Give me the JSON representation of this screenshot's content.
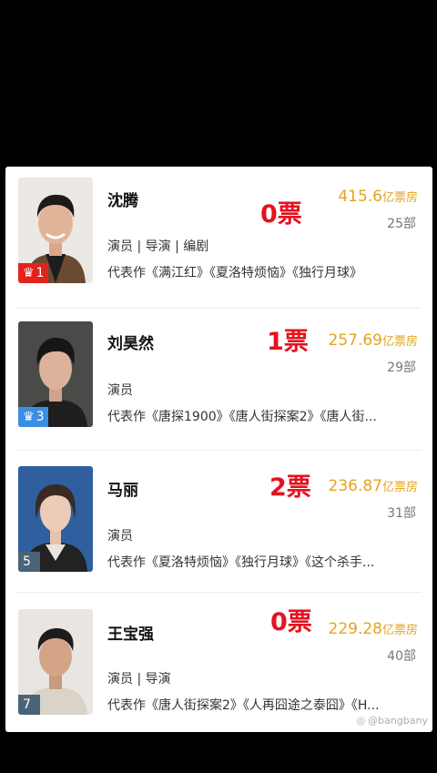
{
  "rows": [
    {
      "rank": "1",
      "rank_color": "#e3231d",
      "crown": true,
      "name": "沈腾",
      "votes": "0票",
      "box_value": "415.6",
      "box_unit": "亿票房",
      "count": "25部",
      "roles": "演员 | 导演 | 编剧",
      "works": "代表作《满江红》《夏洛特烦恼》《独行月球》"
    },
    {
      "rank": "3",
      "rank_color": "#3a8fe4",
      "crown": true,
      "name": "刘昊然",
      "votes": "1票",
      "box_value": "257.69",
      "box_unit": "亿票房",
      "count": "29部",
      "roles": "演员",
      "works": "代表作《唐探1900》《唐人街探案2》《唐人街..."
    },
    {
      "rank": "5",
      "rank_color": "#4a6377",
      "crown": false,
      "name": "马丽",
      "votes": "2票",
      "box_value": "236.87",
      "box_unit": "亿票房",
      "count": "31部",
      "roles": "演员",
      "works": "代表作《夏洛特烦恼》《独行月球》《这个杀手..."
    },
    {
      "rank": "7",
      "rank_color": "#4a6377",
      "crown": false,
      "name": "王宝强",
      "votes": "0票",
      "box_value": "229.28",
      "box_unit": "亿票房",
      "count": "40部",
      "roles": "演员 | 导演",
      "works": "代表作《唐人街探案2》《人再囧途之泰囧》《H..."
    }
  ],
  "watermark": "@bangbany"
}
